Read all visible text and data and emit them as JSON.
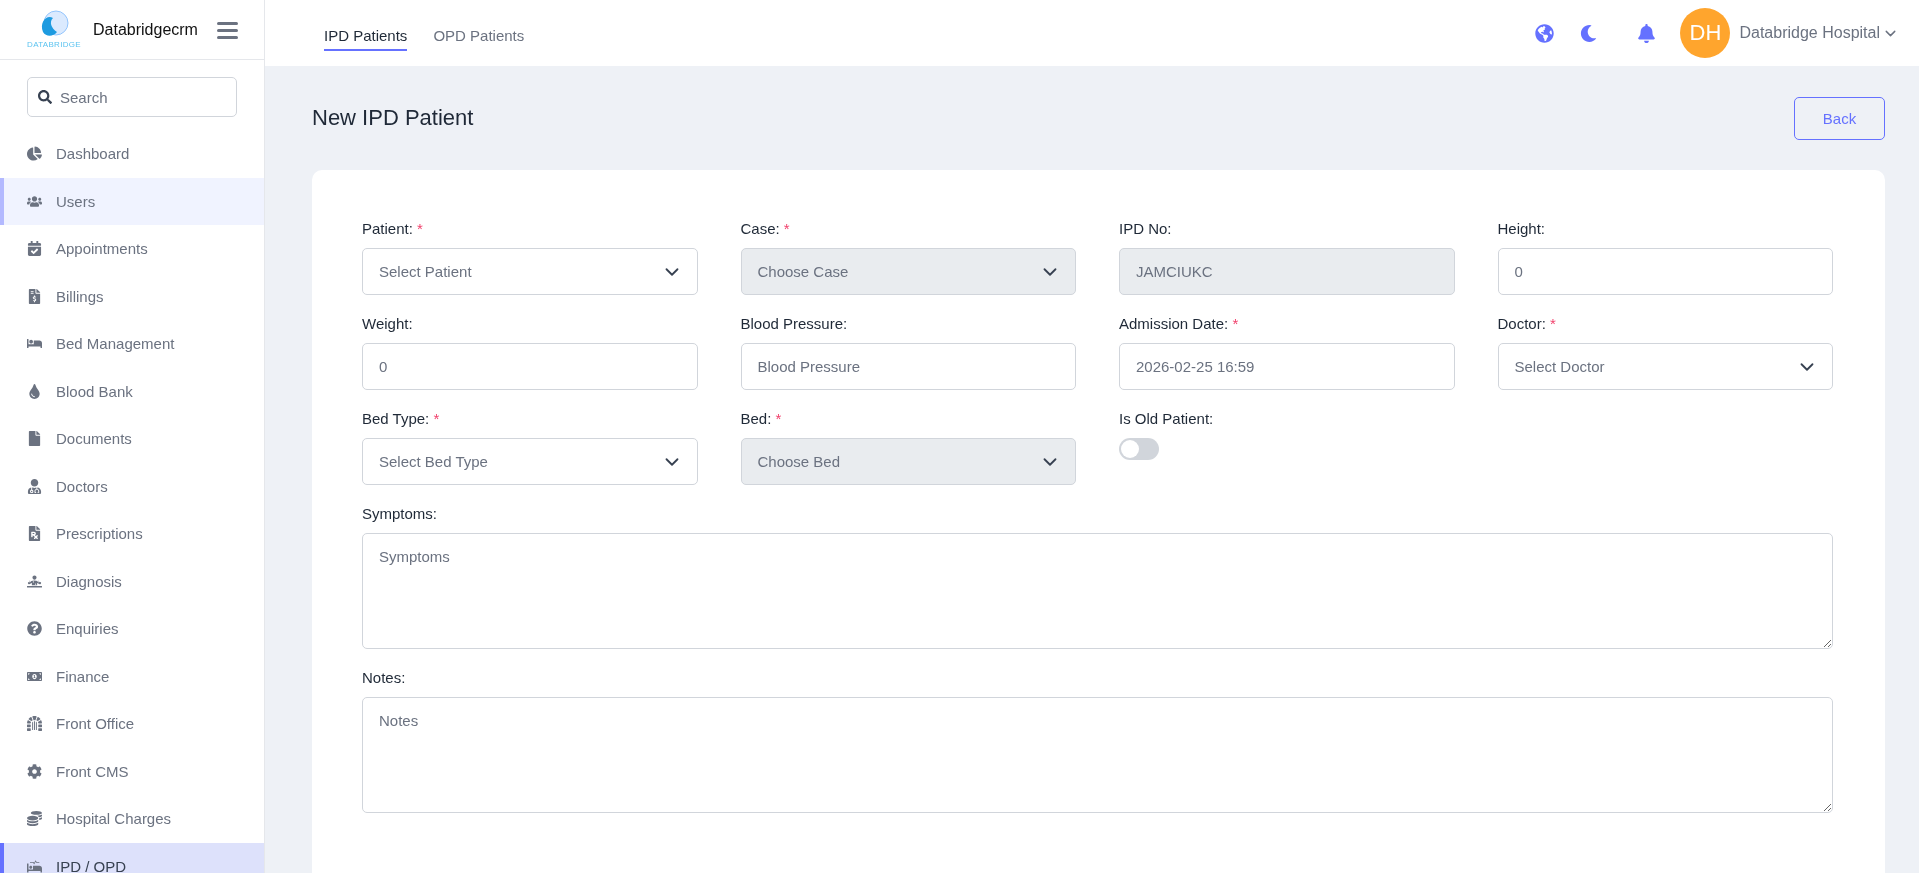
{
  "brand": {
    "logo_text": "DATABRIDGE",
    "name": "Databridgecrm"
  },
  "sidebar": {
    "search": {
      "placeholder": "Search"
    },
    "items": [
      {
        "label": "Dashboard",
        "selected": false,
        "highlighted": false
      },
      {
        "label": "Users",
        "selected": false,
        "highlighted": true
      },
      {
        "label": "Appointments",
        "selected": false,
        "highlighted": false
      },
      {
        "label": "Billings",
        "selected": false,
        "highlighted": false
      },
      {
        "label": "Bed Management",
        "selected": false,
        "highlighted": false
      },
      {
        "label": "Blood Bank",
        "selected": false,
        "highlighted": false
      },
      {
        "label": "Documents",
        "selected": false,
        "highlighted": false
      },
      {
        "label": "Doctors",
        "selected": false,
        "highlighted": false
      },
      {
        "label": "Prescriptions",
        "selected": false,
        "highlighted": false
      },
      {
        "label": "Diagnosis",
        "selected": false,
        "highlighted": false
      },
      {
        "label": "Enquiries",
        "selected": false,
        "highlighted": false
      },
      {
        "label": "Finance",
        "selected": false,
        "highlighted": false
      },
      {
        "label": "Front Office",
        "selected": false,
        "highlighted": false
      },
      {
        "label": "Front CMS",
        "selected": false,
        "highlighted": false
      },
      {
        "label": "Hospital Charges",
        "selected": false,
        "highlighted": false
      },
      {
        "label": "IPD / OPD",
        "selected": true,
        "highlighted": false
      }
    ]
  },
  "tabs": [
    {
      "label": "IPD Patients",
      "selected": true
    },
    {
      "label": "OPD Patients",
      "selected": false
    }
  ],
  "user": {
    "initials": "DH",
    "name": "Databridge Hospital"
  },
  "page": {
    "title": "New IPD Patient",
    "back_button": "Back"
  },
  "fields": [
    {
      "kind": "select",
      "label": "Patient:",
      "required_mark": "*",
      "placeholder": "Select Patient",
      "disabled": false
    },
    {
      "kind": "select",
      "label": "Case:",
      "required_mark": "*",
      "placeholder": "Choose Case",
      "disabled": true
    },
    {
      "kind": "input",
      "label": "IPD No:",
      "value": "JAMCIUKC",
      "disabled": true
    },
    {
      "kind": "input",
      "label": "Height:",
      "value": "0",
      "disabled": false
    },
    {
      "kind": "input",
      "label": "Weight:",
      "value": "0",
      "disabled": false
    },
    {
      "kind": "input",
      "label": "Blood Pressure:",
      "placeholder": "Blood Pressure",
      "disabled": false
    },
    {
      "kind": "input",
      "label": "Admission Date:",
      "required_mark": "*",
      "value": "2026-02-25 16:59",
      "disabled": false
    },
    {
      "kind": "select",
      "label": "Doctor:",
      "required_mark": "*",
      "placeholder": "Select Doctor",
      "disabled": false
    },
    {
      "kind": "select",
      "label": "Bed Type:",
      "required_mark": "*",
      "placeholder": "Select Bed Type",
      "disabled": false
    },
    {
      "kind": "select",
      "label": "Bed:",
      "required_mark": "*",
      "placeholder": "Choose Bed",
      "disabled": true
    },
    {
      "kind": "toggle",
      "label": "Is Old Patient:",
      "on": false
    }
  ],
  "textareas": [
    {
      "label": "Symptoms:",
      "placeholder": "Symptoms"
    },
    {
      "label": "Notes:",
      "placeholder": "Notes"
    }
  ]
}
